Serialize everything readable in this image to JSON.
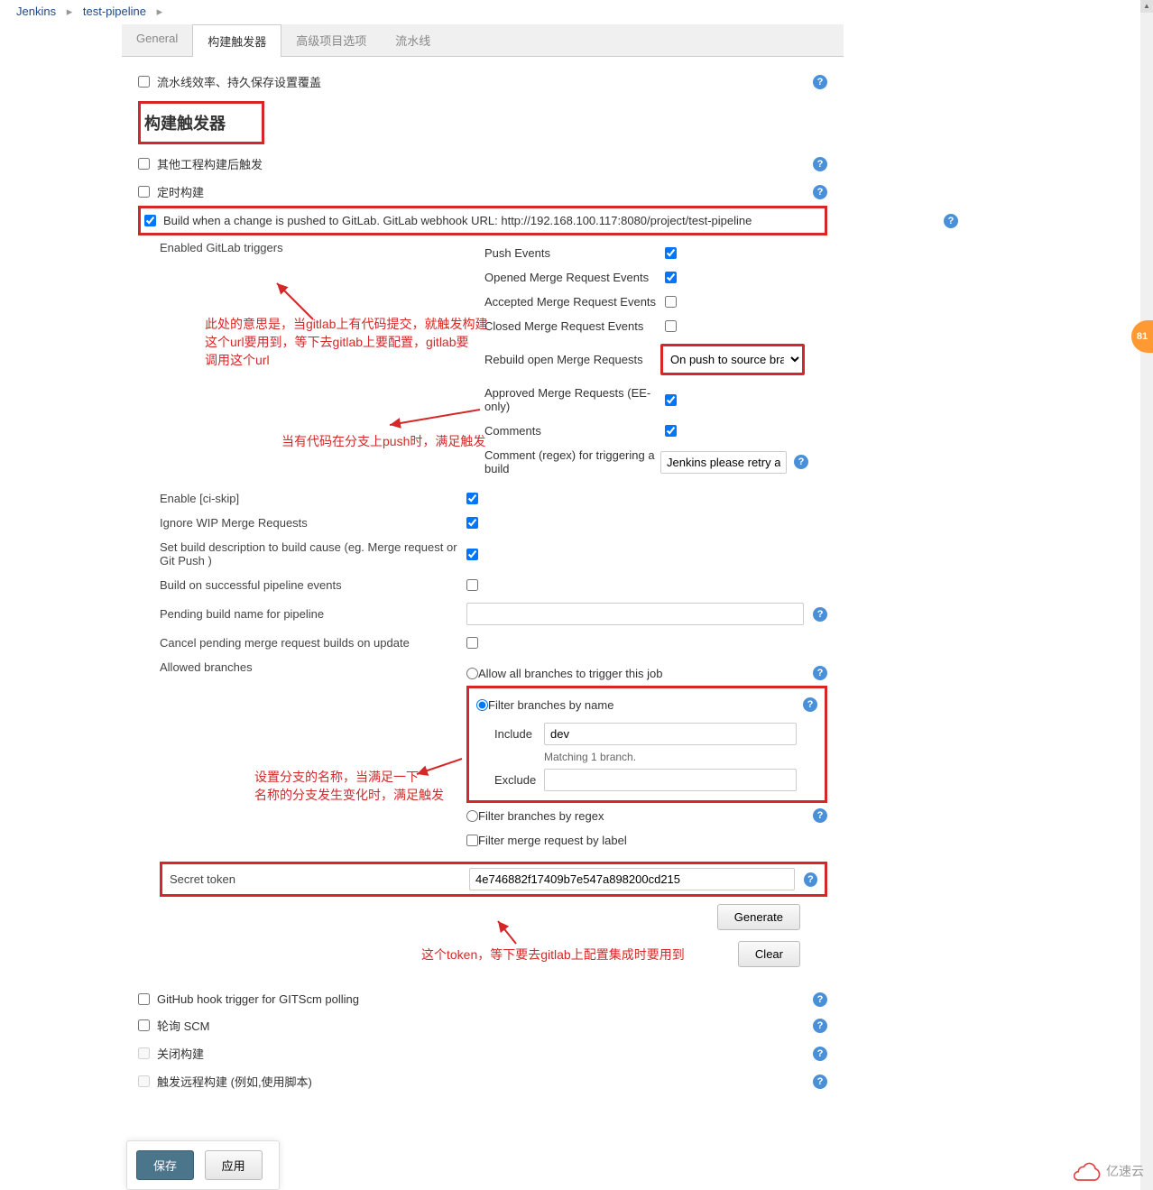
{
  "breadcrumb": {
    "root": "Jenkins",
    "item": "test-pipeline"
  },
  "tabs": {
    "general": "General",
    "triggers": "构建触发器",
    "advanced": "高级项目选项",
    "pipeline": "流水线"
  },
  "opts": {
    "persist_label": "流水线效率、持久保存设置覆盖"
  },
  "section_title": "构建触发器",
  "trigger_opts": {
    "other_proj": "其他工程构建后触发",
    "timed": "定时构建",
    "gitlab": "Build when a change is pushed to GitLab. GitLab webhook URL: http://192.168.100.117:8080/project/test-pipeline"
  },
  "gitlab": {
    "enabled_label": "Enabled GitLab triggers",
    "push_events": "Push Events",
    "opened_mr": "Opened Merge Request Events",
    "accepted_mr": "Accepted Merge Request Events",
    "closed_mr": "Closed Merge Request Events",
    "rebuild_mr": "Rebuild open Merge Requests",
    "rebuild_mr_sel": "On push to source bra",
    "approved_mr": "Approved Merge Requests (EE-only)",
    "comments": "Comments",
    "comment_regex": "Comment (regex) for triggering a build",
    "comment_regex_val": "Jenkins please retry a buil",
    "enable_ciskip": "Enable [ci-skip]",
    "ignore_wip": "Ignore WIP Merge Requests",
    "set_build_desc": "Set build description to build cause (eg. Merge request or Git Push )",
    "build_on_success": "Build on successful pipeline events",
    "pending_name": "Pending build name for pipeline",
    "cancel_pending": "Cancel pending merge request builds on update",
    "allowed_branches": "Allowed branches",
    "allow_all": "Allow all branches to trigger this job",
    "filter_name": "Filter branches by name",
    "include": "Include",
    "include_val": "dev",
    "matching": "Matching 1 branch.",
    "exclude": "Exclude",
    "filter_regex": "Filter branches by regex",
    "filter_label": "Filter merge request by label",
    "secret_token": "Secret token",
    "secret_val": "4e746882f17409b7e547a898200cd215",
    "generate": "Generate",
    "clear": "Clear"
  },
  "more_triggers": {
    "github_hook": "GitHub hook trigger for GITScm polling",
    "poll_scm": "轮询 SCM",
    "disable_build": "关闭构建",
    "remote_trigger": "触发远程构建 (例如,使用脚本)"
  },
  "buttons": {
    "save": "保存",
    "apply": "应用"
  },
  "annotations": {
    "a1": "此处的意思是，当gitlab上有代码提交，就触发构建\n这个url要用到，等下去gitlab上要配置，gitlab要\n调用这个url",
    "a2": "当有代码在分支上push时，满足触发",
    "a3": "设置分支的名称，当满足一下\n名称的分支发生变化时，满足触发",
    "a4": "这个token，等下要去gitlab上配置集成时要用到"
  },
  "watermark": "亿速云",
  "side_badge": "81"
}
